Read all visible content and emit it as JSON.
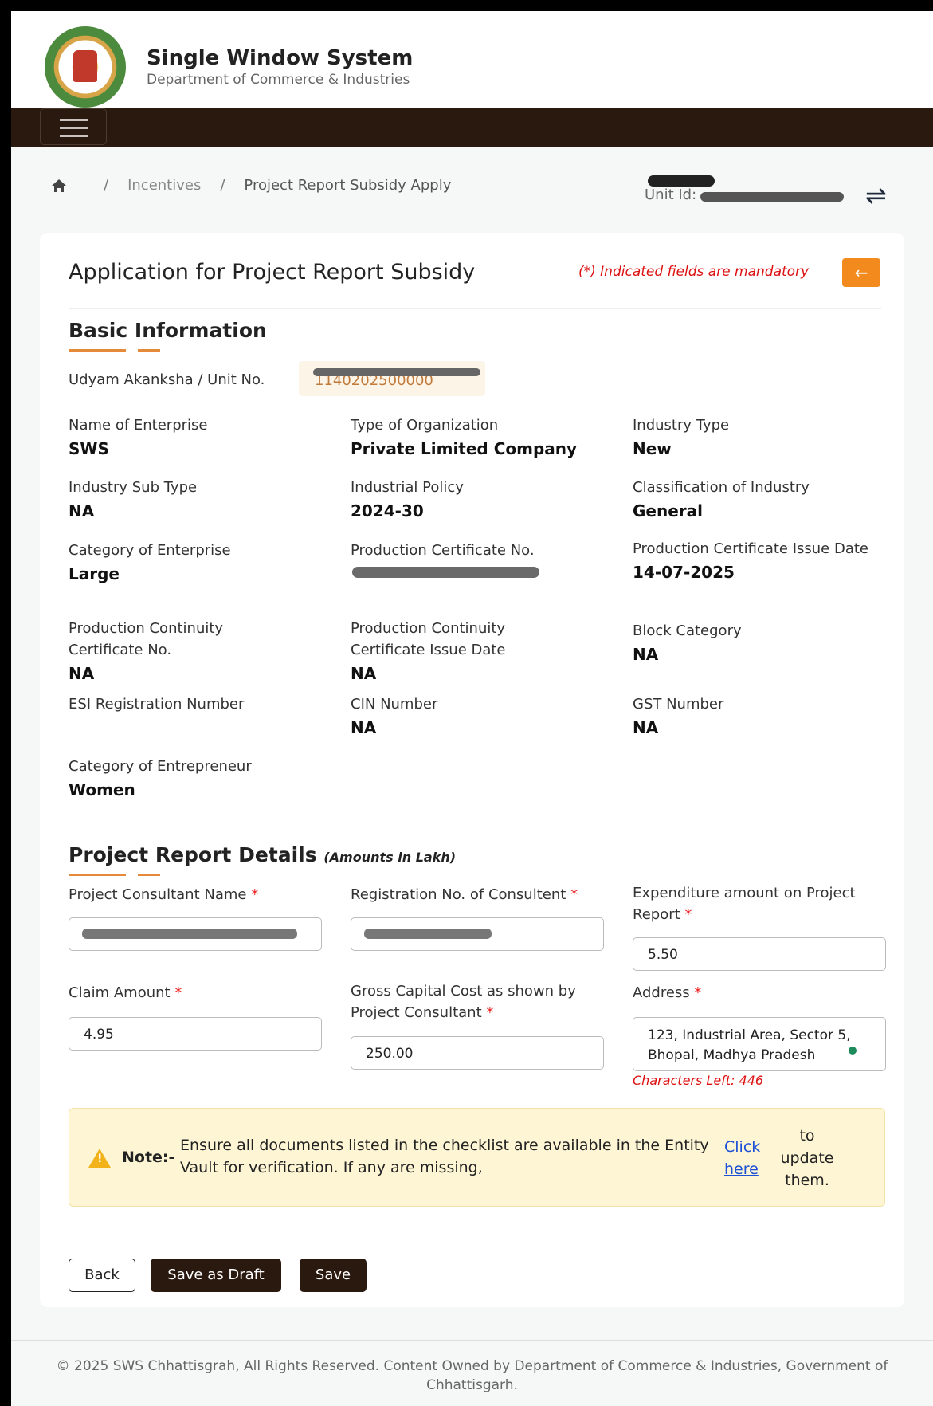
{
  "header": {
    "title": "Single Window System",
    "subtitle": "Department of Commerce & Industries"
  },
  "breadcrumb": {
    "items": [
      "Incentives",
      "Project Report Subsidy Apply"
    ]
  },
  "unit": {
    "label": "Unit Id:"
  },
  "form": {
    "title": "Application for Project Report Subsidy",
    "mandatory_note": "(*) Indicated fields are mandatory",
    "basic_section": "Basic Information",
    "udyam_label": "Udyam Akanksha / Unit No.",
    "udyam_value": "1140202500000",
    "fields": {
      "name_label": "Name of Enterprise",
      "name_value": "SWS",
      "org_label": "Type of Organization",
      "org_value": "Private Limited Company",
      "ind_type_label": "Industry Type",
      "ind_type_value": "New",
      "subtype_label": "Industry Sub Type",
      "subtype_value": "NA",
      "policy_label": "Industrial Policy",
      "policy_value": "2024-30",
      "class_label": "Classification of Industry",
      "class_value": "General",
      "category_label": "Category of Enterprise",
      "category_value": "Large",
      "prod_cert_label": "Production Certificate No.",
      "prod_date_label": "Production Certificate Issue Date",
      "prod_date_value": "14-07-2025",
      "cont_cert_label": "Production Continuity Certificate No.",
      "cont_cert_value": "NA",
      "cont_date_label": "Production Continuity Certificate Issue Date",
      "cont_date_value": "NA",
      "block_label": "Block Category",
      "block_value": "NA",
      "esi_label": "ESI Registration Number",
      "cin_label": "CIN Number",
      "cin_value": "NA",
      "gst_label": "GST Number",
      "gst_value": "NA",
      "entrepreneur_label": "Category of Entrepreneur",
      "entrepreneur_value": "Women"
    },
    "project_section": "Project Report Details",
    "project_section_note": "(Amounts in Lakh)",
    "inputs": {
      "consultant_label": "Project Consultant Name",
      "registration_label": "Registration No. of Consultent",
      "expenditure_label": "Expenditure amount on Project Report",
      "expenditure_value": "5.50",
      "claim_label": "Claim Amount",
      "claim_value": "4.95",
      "gross_label": "Gross Capital Cost as shown by Project Consultant",
      "gross_value": "250.00",
      "address_label": "Address",
      "address_value": "123, Industrial Area, Sector 5, Bhopal, Madhya Pradesh",
      "chars_left": "Characters Left: 446",
      "required_mark": "*"
    },
    "note": {
      "label": "Note:-",
      "text": "Ensure all documents listed in the checklist are available in the Entity Vault for verification. If any are missing,",
      "link": "Click here",
      "after": "to update them."
    },
    "buttons": {
      "back": "Back",
      "draft": "Save as Draft",
      "save": "Save"
    }
  },
  "footer": "© 2025 SWS Chhattisgrah, All Rights Reserved. Content Owned by Department of Commerce & Industries, Government of Chhattisgarh."
}
